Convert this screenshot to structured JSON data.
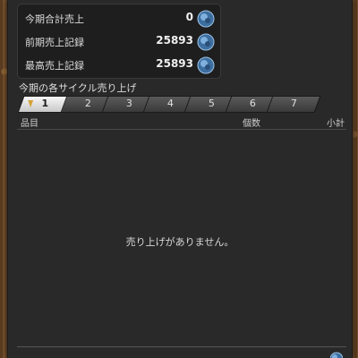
{
  "summary": {
    "rows": [
      {
        "label": "今期合計売上",
        "value": "0"
      },
      {
        "label": "前期売上記録",
        "value": "25893"
      },
      {
        "label": "最高売上記録",
        "value": "25893"
      }
    ]
  },
  "cycle": {
    "title": "今期の各サイクル売り上げ",
    "tabs": [
      "1",
      "2",
      "3",
      "4",
      "5",
      "6",
      "7"
    ],
    "active_tab": "1"
  },
  "table": {
    "headers": {
      "item": "品目",
      "count": "個数",
      "subtotal": "小計"
    },
    "empty_message": "売り上げがありません。"
  },
  "colors": {
    "panel": "#292929",
    "active_tab": "#e6e6e6",
    "marker": "#d7a23a"
  },
  "icons": {
    "currency": "gil-coin-icon"
  }
}
